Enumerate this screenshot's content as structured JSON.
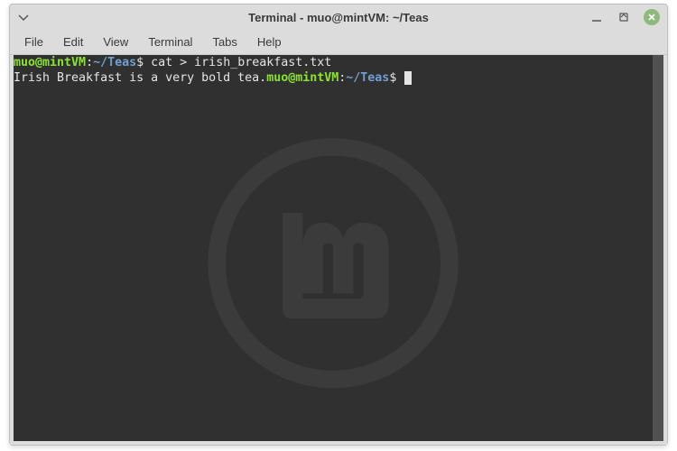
{
  "window": {
    "title": "Terminal - muo@mintVM: ~/Teas"
  },
  "menu": {
    "file": "File",
    "edit": "Edit",
    "view": "View",
    "terminal": "Terminal",
    "tabs": "Tabs",
    "help": "Help"
  },
  "term": {
    "line1": {
      "user": "muo@mintVM",
      "colon": ":",
      "path": "~/Teas",
      "dollar": "$ ",
      "command": "cat > irish_breakfast.txt"
    },
    "line2": {
      "output": "Irish Breakfast is a very bold tea.",
      "user": "muo@mintVM",
      "colon": ":",
      "path": "~/Teas",
      "dollar": "$ "
    }
  }
}
